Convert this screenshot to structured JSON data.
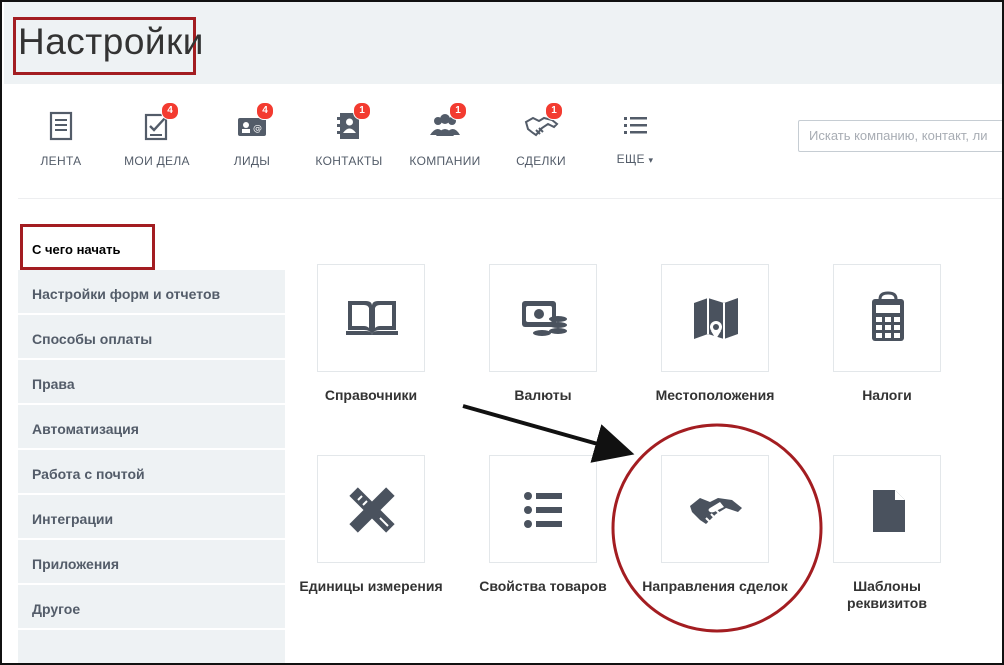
{
  "page": {
    "title": "Настройки"
  },
  "nav": {
    "items": [
      {
        "label": "ЛЕНТА",
        "icon": "feed-icon",
        "badge": ""
      },
      {
        "label": "МОИ ДЕЛА",
        "icon": "tasks-icon",
        "badge": "4"
      },
      {
        "label": "ЛИДЫ",
        "icon": "leads-icon",
        "badge": "4"
      },
      {
        "label": "КОНТАКТЫ",
        "icon": "contacts-icon",
        "badge": "1"
      },
      {
        "label": "КОМПАНИИ",
        "icon": "companies-icon",
        "badge": "1"
      },
      {
        "label": "СДЕЛКИ",
        "icon": "deals-icon",
        "badge": "1"
      },
      {
        "label": "ЕЩЕ",
        "icon": "more-icon",
        "badge": ""
      }
    ],
    "more_caret": "▾"
  },
  "search": {
    "placeholder": "Искать компанию, контакт, ли"
  },
  "sidebar": {
    "items": [
      {
        "label": "С чего начать"
      },
      {
        "label": "Настройки форм и отчетов"
      },
      {
        "label": "Способы оплаты"
      },
      {
        "label": "Права"
      },
      {
        "label": "Автоматизация"
      },
      {
        "label": "Работа с почтой"
      },
      {
        "label": "Интеграции"
      },
      {
        "label": "Приложения"
      },
      {
        "label": "Другое"
      }
    ]
  },
  "tiles": {
    "items": [
      {
        "label": "Справочники",
        "icon": "book-icon"
      },
      {
        "label": "Валюты",
        "icon": "currency-icon"
      },
      {
        "label": "Местоположения",
        "icon": "map-icon"
      },
      {
        "label": "Налоги",
        "icon": "calculator-icon"
      },
      {
        "label": "Единицы измерения",
        "icon": "ruler-pencil-icon"
      },
      {
        "label": "Свойства товаров",
        "icon": "list-icon"
      },
      {
        "label": "Направления сделок",
        "icon": "handshake-icon"
      },
      {
        "label": "Шаблоны реквизитов",
        "icon": "document-icon"
      }
    ]
  },
  "colors": {
    "highlight": "#a31d21",
    "badge": "#f33b30",
    "icon": "#4a525e",
    "panel": "#eef2f4"
  }
}
